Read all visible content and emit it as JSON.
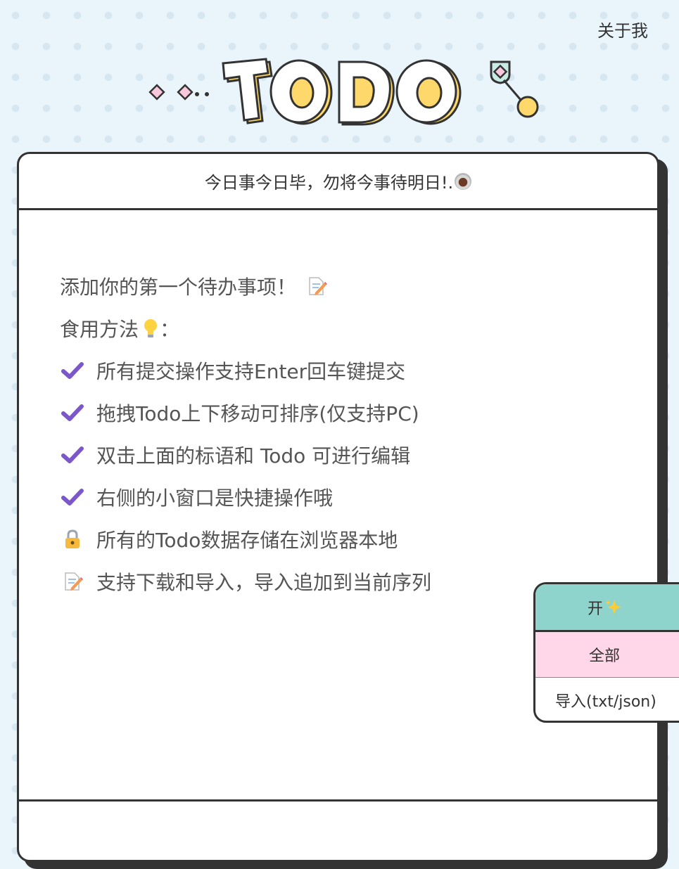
{
  "nav": {
    "about_label": "关于我"
  },
  "logo": {
    "text": "TODO"
  },
  "header": {
    "slogan": "今日事今日毕，勿将今事待明日!."
  },
  "intro": {
    "first_todo": "添加你的第一个待办事项！",
    "usage": "食用方法",
    "usage_colon": "："
  },
  "tips": [
    {
      "icon": "check-icon",
      "text": "所有提交操作支持Enter回车键提交"
    },
    {
      "icon": "check-icon",
      "text": "拖拽Todo上下移动可排序(仅支持PC)"
    },
    {
      "icon": "check-icon",
      "text": "双击上面的标语和 Todo 可进行编辑"
    },
    {
      "icon": "check-icon",
      "text": "右侧的小窗口是快捷操作哦"
    },
    {
      "icon": "lock-icon",
      "text": "所有的Todo数据存储在浏览器本地"
    },
    {
      "icon": "memo-icon",
      "text": "支持下载和导入，导入追加到当前序列"
    }
  ],
  "quick_menu": {
    "toggle_label": "开",
    "filter_label": "全部",
    "import_label": "导入(txt/json)"
  },
  "colors": {
    "background": "#e9f4fb",
    "check": "#7b57c9",
    "menu_toggle_bg": "#8ed4cc",
    "menu_filter_bg": "#ffd7e8",
    "logo_yellow": "#ffd86b"
  }
}
